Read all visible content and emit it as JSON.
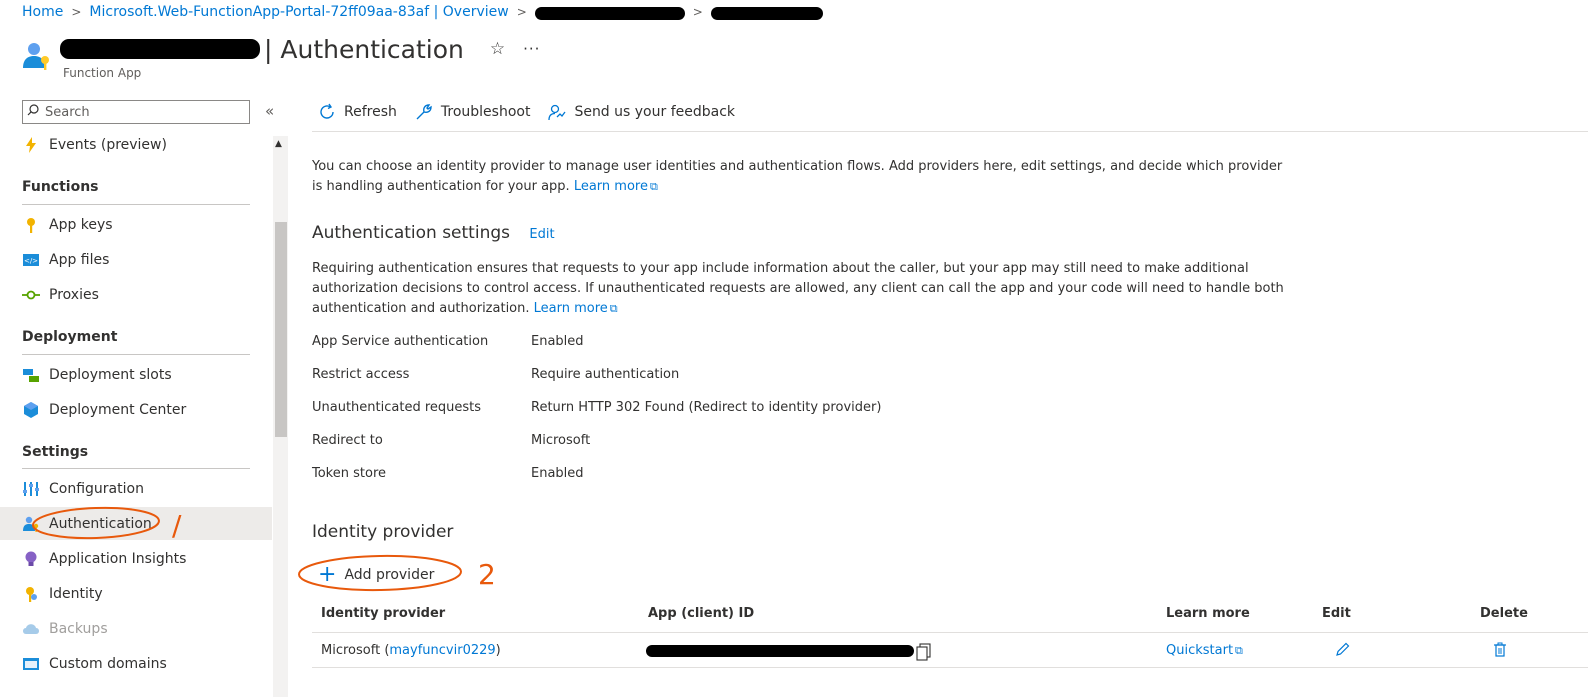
{
  "breadcrumb": {
    "home": "Home",
    "overview": "Microsoft.Web-FunctionApp-Portal-72ff09aa-83af | Overview"
  },
  "header": {
    "title_suffix": "| Authentication",
    "subtitle": "Function App",
    "star_icon": "star-icon",
    "more_icon": "ellipsis"
  },
  "sidebar": {
    "search_placeholder": "Search",
    "collapse_label": "«",
    "items": {
      "events": "Events (preview)",
      "functions_head": "Functions",
      "app_keys": "App keys",
      "app_files": "App files",
      "proxies": "Proxies",
      "deployment_head": "Deployment",
      "deployment_slots": "Deployment slots",
      "deployment_center": "Deployment Center",
      "settings_head": "Settings",
      "configuration": "Configuration",
      "authentication": "Authentication",
      "application_insights": "Application Insights",
      "identity": "Identity",
      "backups": "Backups",
      "custom_domains": "Custom domains"
    }
  },
  "toolbar": {
    "refresh": "Refresh",
    "troubleshoot": "Troubleshoot",
    "feedback": "Send us your feedback"
  },
  "intro": {
    "text": "You can choose an identity provider to manage user identities and authentication flows. Add providers here, edit settings, and decide which provider is handling authentication for your app.",
    "learn_more": "Learn more"
  },
  "auth_settings": {
    "heading": "Authentication settings",
    "edit": "Edit",
    "description": "Requiring authentication ensures that requests to your app include information about the caller, but your app may still need to make additional authorization decisions to control access. If unauthenticated requests are allowed, any client can call the app and your code will need to handle both authentication and authorization.",
    "learn_more": "Learn more",
    "rows": [
      {
        "key": "App Service authentication",
        "value": "Enabled"
      },
      {
        "key": "Restrict access",
        "value": "Require authentication"
      },
      {
        "key": "Unauthenticated requests",
        "value": "Return HTTP 302 Found (Redirect to identity provider)"
      },
      {
        "key": "Redirect to",
        "value": "Microsoft"
      },
      {
        "key": "Token store",
        "value": "Enabled"
      }
    ]
  },
  "identity_provider": {
    "heading": "Identity provider",
    "add_provider": "Add provider",
    "columns": [
      "Identity provider",
      "App (client) ID",
      "Learn more",
      "Edit",
      "Delete"
    ],
    "row": {
      "provider": "Microsoft",
      "app_name_open": "(",
      "app_name": "mayfuncvir0229",
      "app_name_close": ")",
      "learn_more": "Quickstart"
    }
  },
  "annotations": {
    "mark_1": "/",
    "mark_2": "2"
  },
  "colors": {
    "accent": "#0078d4",
    "annotation": "#e8590c",
    "selected_bg": "#edebe9"
  }
}
